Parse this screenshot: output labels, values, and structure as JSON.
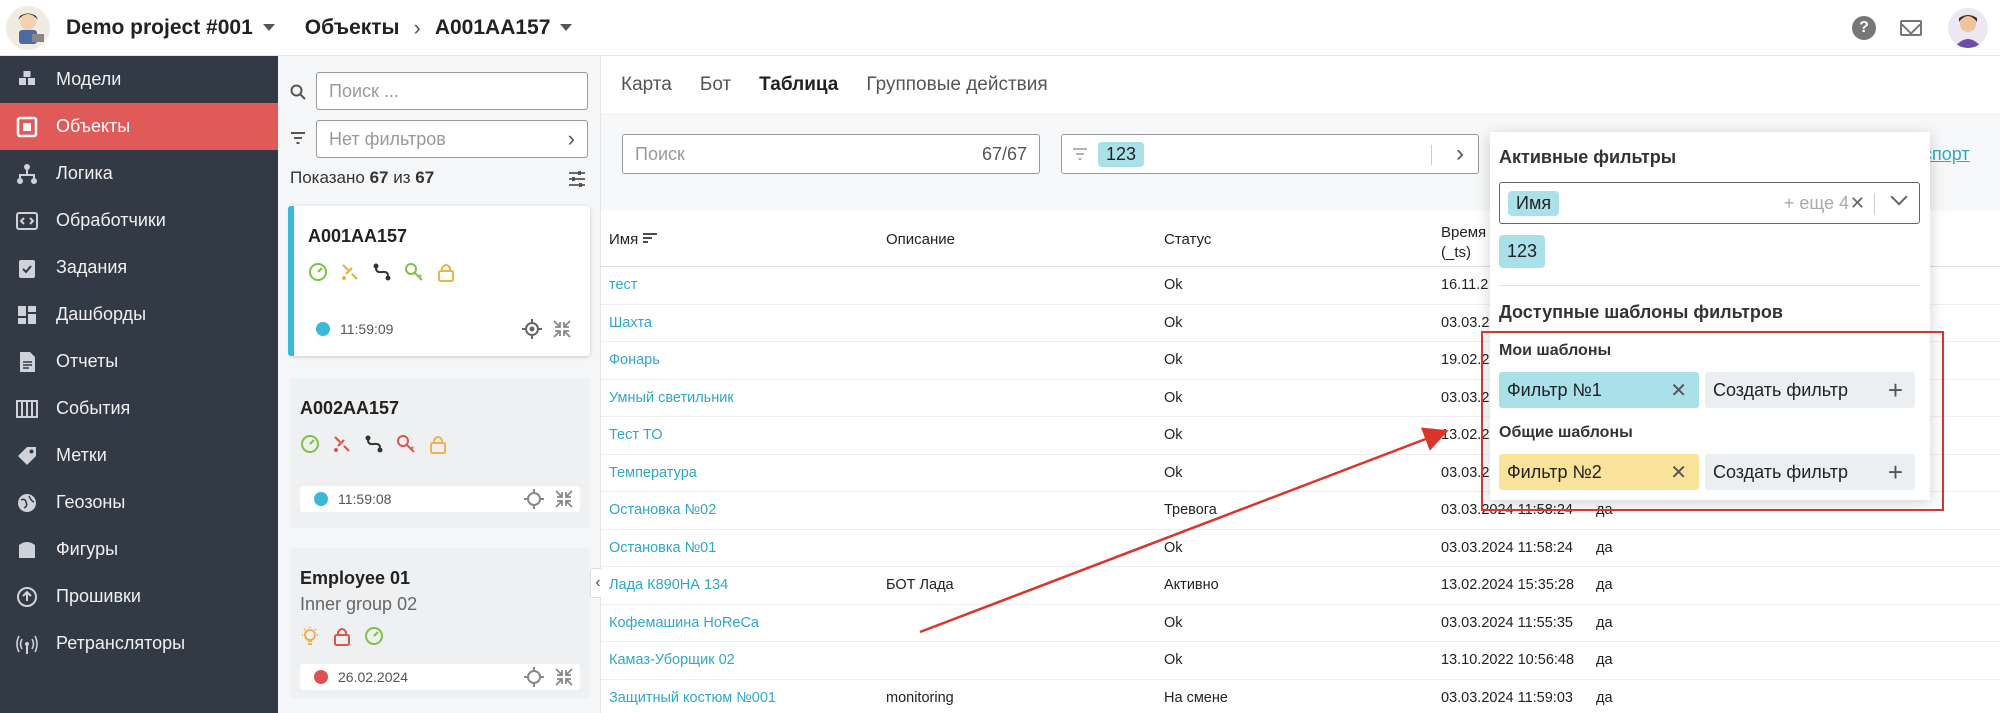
{
  "header": {
    "project": "Demo project #001",
    "objects": "Объекты",
    "current": "A001AA157"
  },
  "sidebar": {
    "items": [
      {
        "label": "Модели",
        "icon": "cubes-icon"
      },
      {
        "label": "Объекты",
        "icon": "object-icon",
        "active": true
      },
      {
        "label": "Логика",
        "icon": "logic-icon"
      },
      {
        "label": "Обработчики",
        "icon": "code-icon"
      },
      {
        "label": "Задания",
        "icon": "clipboard-icon"
      },
      {
        "label": "Дашборды",
        "icon": "dashboard-icon"
      },
      {
        "label": "Отчеты",
        "icon": "report-icon"
      },
      {
        "label": "События",
        "icon": "events-icon"
      },
      {
        "label": "Метки",
        "icon": "tag-icon"
      },
      {
        "label": "Геозоны",
        "icon": "geozone-icon"
      },
      {
        "label": "Фигуры",
        "icon": "shapes-icon"
      },
      {
        "label": "Прошивки",
        "icon": "firmware-icon"
      },
      {
        "label": "Ретрансляторы",
        "icon": "antenna-icon"
      }
    ]
  },
  "list": {
    "search_placeholder": "Поиск ...",
    "filter_placeholder": "Нет фильтров",
    "shown_prefix": "Показано",
    "shown_count": "67",
    "shown_mid": "из",
    "shown_total": "67",
    "cards": [
      {
        "title": "A001AA157",
        "time": "11:59:09",
        "dot": "#3bb8d6"
      },
      {
        "title": "A002AA157",
        "time": "11:59:08",
        "dot": "#3bb8d6"
      },
      {
        "title": "Employee 01",
        "subtitle": "Inner group 02",
        "time": "26.02.2024",
        "dot": "#e05050"
      }
    ]
  },
  "tabs": [
    "Карта",
    "Бот",
    "Таблица",
    "Групповые действия"
  ],
  "toolbar": {
    "search_placeholder": "Поиск",
    "search_count": "67/67",
    "filter_chip": "123",
    "export_label": "спорт"
  },
  "table": {
    "columns": [
      "Имя",
      "Описание",
      "Статус",
      "Время",
      "(_ts)"
    ],
    "rows": [
      {
        "name": "тест",
        "desc": "",
        "status": "Ok",
        "time": "16.11.2",
        "extra": ""
      },
      {
        "name": "Шахта",
        "desc": "",
        "status": "Ok",
        "time": "03.03.2",
        "extra": ""
      },
      {
        "name": "Фонарь",
        "desc": "",
        "status": "Ok",
        "time": "19.02.2",
        "extra": ""
      },
      {
        "name": "Умный светильник",
        "desc": "",
        "status": "Ok",
        "time": "03.03.2",
        "extra": ""
      },
      {
        "name": "Тест ТО",
        "desc": "",
        "status": "Ok",
        "time": "13.02.2",
        "extra": ""
      },
      {
        "name": "Температура",
        "desc": "",
        "status": "Ok",
        "time": "03.03.2",
        "extra": ""
      },
      {
        "name": "Остановка №02",
        "desc": "",
        "status": "Тревога",
        "time": "03.03.2024 11:58:24",
        "extra": "да"
      },
      {
        "name": "Остановка №01",
        "desc": "",
        "status": "Ok",
        "time": "03.03.2024 11:58:24",
        "extra": "да"
      },
      {
        "name": "Лада К890НА 134",
        "desc": "БОТ Лада",
        "status": "Активно",
        "time": "13.02.2024 15:35:28",
        "extra": "да"
      },
      {
        "name": "Кофемашина HoReCa",
        "desc": "",
        "status": "Ok",
        "time": "03.03.2024 11:55:35",
        "extra": "да"
      },
      {
        "name": "Камаз-Уборщик 02",
        "desc": "",
        "status": "Ok",
        "time": "13.10.2022 10:56:48",
        "extra": "да"
      },
      {
        "name": "Защитный костюм №001",
        "desc": "monitoring",
        "status": "На смене",
        "time": "03.03.2024 11:59:03",
        "extra": "да"
      }
    ]
  },
  "popover": {
    "active_title": "Активные фильтры",
    "select_chip": "Имя",
    "more": "+ еще 4",
    "lone_chip": "123",
    "templates_title": "Доступные шаблоны фильтров",
    "my_title": "Мои шаблоны",
    "my_filter": "Фильтр №1",
    "create_label": "Создать фильтр",
    "shared_title": "Общие шаблоны",
    "shared_filter": "Фильтр №2",
    "create_label_2": "Создать фильтр"
  },
  "colors": {
    "sidebar_bg": "#323a45",
    "active_nav": "#e05a5a",
    "accent": "#2fa7c9",
    "chip_blue": "#a9e0ea",
    "chip_yellow": "#f9e39a",
    "highlight": "#d8362c"
  }
}
